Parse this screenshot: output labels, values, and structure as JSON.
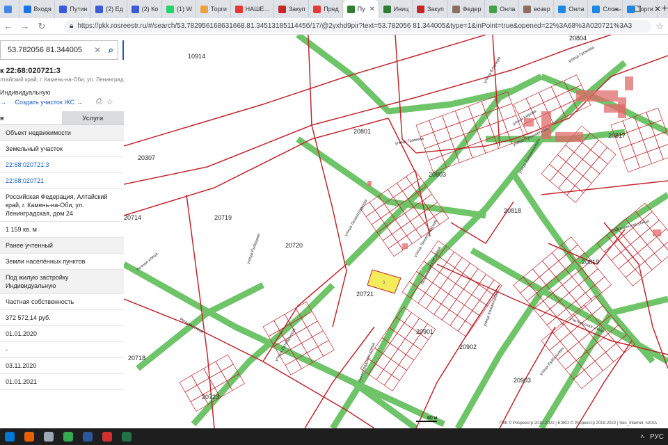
{
  "browser": {
    "tabs": [
      {
        "label": "",
        "color": "#4a86e8"
      },
      {
        "label": "Входя",
        "color": "#1a73e8"
      },
      {
        "label": "Путин",
        "color": "#3b5bdb"
      },
      {
        "label": "(2) Ед",
        "color": "#3b5bdb"
      },
      {
        "label": "(2) Ко",
        "color": "#3b5bdb"
      },
      {
        "label": "(1) W",
        "color": "#25d366"
      },
      {
        "label": "Торги",
        "color": "#e8a33d"
      },
      {
        "label": "НАШЕ…",
        "color": "#e53935"
      },
      {
        "label": "Закуп",
        "color": "#c62828"
      },
      {
        "label": "Пред",
        "color": "#e53935"
      },
      {
        "label": "Пу",
        "color": "#2e7d32"
      },
      {
        "label": "Иниц",
        "color": "#2e7d32"
      },
      {
        "label": "Закуп",
        "color": "#c62828"
      },
      {
        "label": "Федер",
        "color": "#8d6e63"
      },
      {
        "label": "Онла",
        "color": "#43a047"
      },
      {
        "label": "возвр",
        "color": "#8d6e63"
      },
      {
        "label": "Онла",
        "color": "#1e88e5"
      },
      {
        "label": "Слож",
        "color": "#1e88e5"
      },
      {
        "label": "Торги",
        "color": "#1e88e5"
      }
    ],
    "active_tab_index": 10,
    "url": "https://pkk.rosreestr.ru/#/search/53.782956168631668.81.3451318511445б/17/@2yxhd9pir?text=53.782056 81.344005&type=1&inPoint=true&opened=22%3A68%3A020721%3A3"
  },
  "sidebar": {
    "search_value": "53.782056 81.344005",
    "object_title": "к 22:68:020721:3",
    "object_address": "лтайский край, г. Камень-на-Оби, ул. Ленинградская,",
    "object_use": "Индивидуальную",
    "create_link": "Создать участок ЖС",
    "tab_info": "я",
    "tab_services": "Услуги",
    "rows": [
      {
        "text": "Объект недвижимости",
        "style": "shade"
      },
      {
        "text": "Земельный участок",
        "style": ""
      },
      {
        "text": "22:68:020721:3",
        "style": "link"
      },
      {
        "text": "22:68:020721",
        "style": "link"
      },
      {
        "text": "Российская Федерация, Алтайский край, г. Камень-на-Оби, ул. Ленинградская, дом 24",
        "style": ""
      },
      {
        "text": "1 159 кв. м",
        "style": ""
      },
      {
        "text": "Ранее учтенный",
        "style": "shade"
      },
      {
        "text": "Земли населённых пунктов",
        "style": ""
      },
      {
        "text": "Под жилую застройку Индивидуальную",
        "style": "shade"
      },
      {
        "text": "Частная собственность",
        "style": ""
      },
      {
        "text": "372 572,14 руб.",
        "style": ""
      },
      {
        "text": "01.01.2020",
        "style": ""
      },
      {
        "text": "-",
        "style": ""
      },
      {
        "text": "03.11.2020",
        "style": ""
      },
      {
        "text": "01.01.2021",
        "style": ""
      }
    ]
  },
  "map": {
    "quarter_labels": [
      "10914",
      "20804",
      "20801",
      "20307",
      "20817",
      "20803",
      "20714",
      "20719",
      "20720",
      "20818",
      "20819",
      "20721",
      "20901",
      "20902",
      "20718",
      "20723",
      "20903"
    ],
    "street_labels": [
      "улица Громова",
      "улица Блюхера",
      "улица Кирова",
      "улица Громова",
      "улица Луначарского",
      "улица Дзержинского",
      "улица Ленинградская",
      "улица Ленинградская",
      "Партизанская улица",
      "Речная улица",
      "улица Рыбацкая",
      "Ленинградская улица",
      "улица Колмогорова",
      "Учительская улица",
      "Речная улица",
      "улица Куйбышева",
      "Ленинградская улица",
      "улица Октябрьская"
    ],
    "scale_label": "60 м",
    "copyright": "ПКК © Росреестр 2010-2022 | ЕЭКО © Росреестр 2019-2022 | Sen_Internet, NASA",
    "colors": {
      "boundary": "#c0262d",
      "street": "#6fc46a",
      "selected": "#f4ec5a",
      "building": "#e06a6a"
    }
  },
  "taskbar": {
    "apps": [
      {
        "name": "windows-icon",
        "color": "#0078d7"
      },
      {
        "name": "firefox-icon",
        "color": "#e66000"
      },
      {
        "name": "files-icon",
        "color": "#9aa7b5"
      },
      {
        "name": "chrome-icon",
        "color": "#34a853"
      },
      {
        "name": "word-icon",
        "color": "#2b579a"
      },
      {
        "name": "rtc-icon",
        "color": "#d32f2f"
      },
      {
        "name": "excel-icon",
        "color": "#217346"
      }
    ],
    "lang": "РУС"
  }
}
